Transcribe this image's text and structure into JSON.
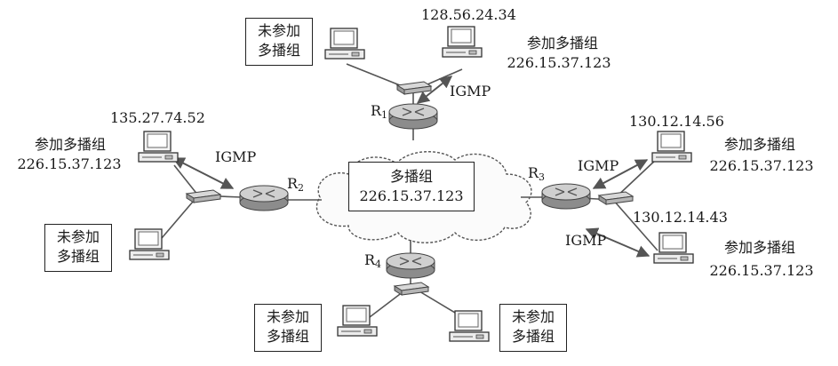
{
  "multicast_group": {
    "title": "多播组",
    "address": "226.15.37.123"
  },
  "routers": {
    "r1": {
      "letter": "R",
      "sub": "1"
    },
    "r2": {
      "letter": "R",
      "sub": "2"
    },
    "r3": {
      "letter": "R",
      "sub": "3"
    },
    "r4": {
      "letter": "R",
      "sub": "4"
    }
  },
  "igmp_label": "IGMP",
  "hosts": {
    "top_left": {
      "line1": "未参加",
      "line2": "多播组"
    },
    "top_right": {
      "ip": "128.56.24.34",
      "status": "参加多播组",
      "group": "226.15.37.123"
    },
    "left_top": {
      "ip": "135.27.74.52",
      "status": "参加多播组",
      "group": "226.15.37.123"
    },
    "left_bottom": {
      "line1": "未参加",
      "line2": "多播组"
    },
    "right_top": {
      "ip": "130.12.14.56",
      "status": "参加多播组",
      "group": "226.15.37.123"
    },
    "right_bottom": {
      "ip": "130.12.14.43",
      "status": "参加多播组",
      "group": "226.15.37.123"
    },
    "bottom_left": {
      "line1": "未参加",
      "line2": "多播组"
    },
    "bottom_right": {
      "line1": "未参加",
      "line2": "多播组"
    }
  }
}
